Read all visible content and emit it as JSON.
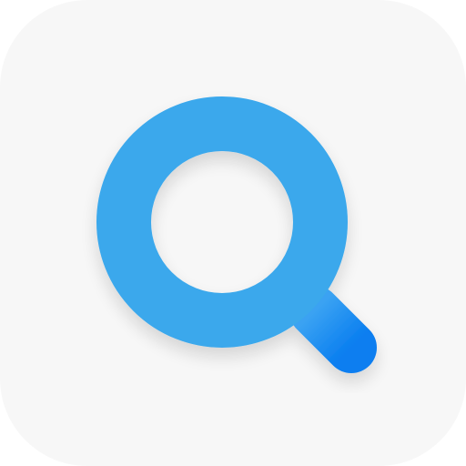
{
  "app_icon": {
    "icon": "search-icon",
    "colors": {
      "tile_background": "#f7f7f7",
      "ring": "#3aa8ec",
      "handle": "#0a7ef0",
      "handle_light": "#2f97f2"
    }
  }
}
